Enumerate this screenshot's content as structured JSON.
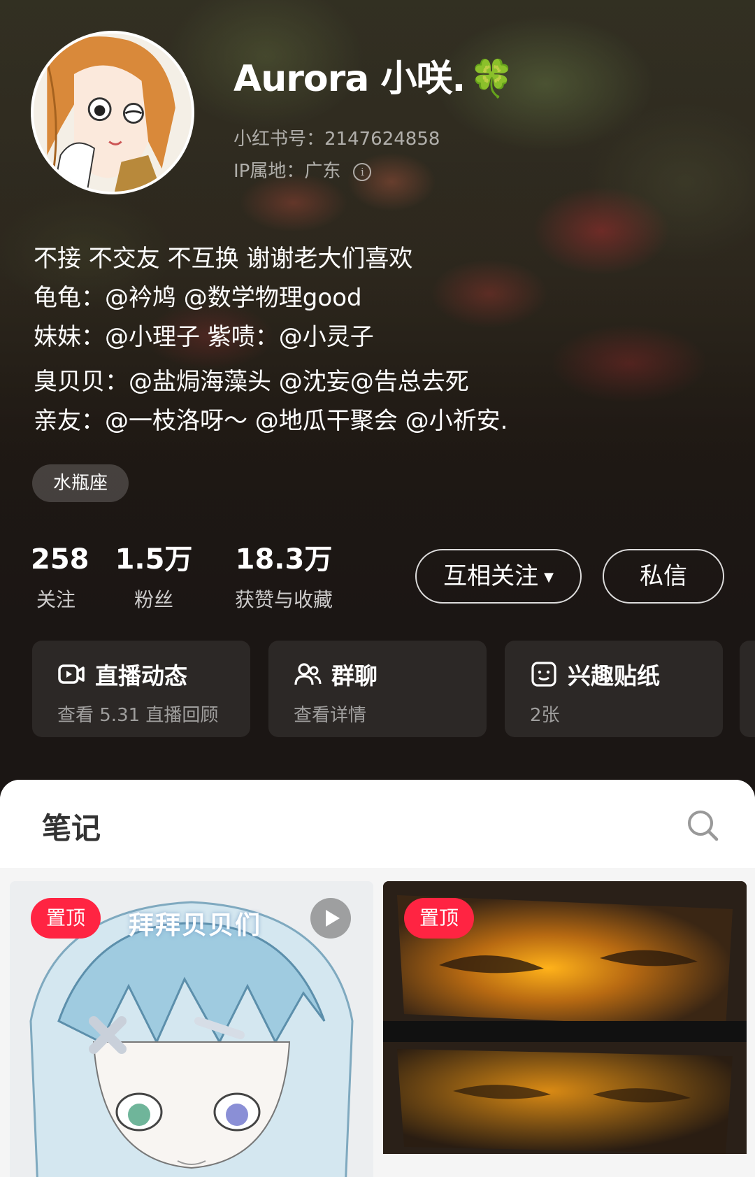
{
  "profile": {
    "name": "Aurora 小咲.",
    "name_emoji": "🍀",
    "id_line": "小红书号：2147624858",
    "ip_line": "IP属地：广东",
    "info_icon": "i",
    "bio": [
      "不接 不交友 不互换 谢谢老大们喜欢",
      "龟龟：@衿鸠 @数学物理good",
      "妹妹：@小理子 紫啧：@小灵子",
      "臭贝贝：@盐焗海藻头 @沈妄@告总去死",
      "亲友：@一枝洛呀～ @地瓜干聚会 @小祈安."
    ],
    "tag": "水瓶座"
  },
  "stats": [
    {
      "num": "258",
      "label": "关注"
    },
    {
      "num": "1.5万",
      "label": "粉丝"
    },
    {
      "num": "18.3万",
      "label": "获赞与收藏"
    }
  ],
  "actions": {
    "follow_label": "互相关注",
    "follow_caret": "▼",
    "message_label": "私信"
  },
  "cards": [
    {
      "title": "直播动态",
      "sub": "查看 5.31 直播回顾",
      "icon": "live-video-icon"
    },
    {
      "title": "群聊",
      "sub": "查看详情",
      "icon": "group-chat-icon"
    },
    {
      "title": "兴趣贴纸",
      "sub": "2张",
      "icon": "sticker-icon"
    }
  ],
  "notes": {
    "tab_label": "笔记",
    "items": [
      {
        "pin_label": "置顶",
        "overlay": "拜拜贝贝们",
        "has_video": true
      },
      {
        "pin_label": "置顶",
        "overlay": "",
        "has_video": false
      }
    ]
  },
  "colors": {
    "accent": "#ff2442",
    "panel_bg": "#f5f5f5",
    "hero_bottom": "#1b1614"
  }
}
